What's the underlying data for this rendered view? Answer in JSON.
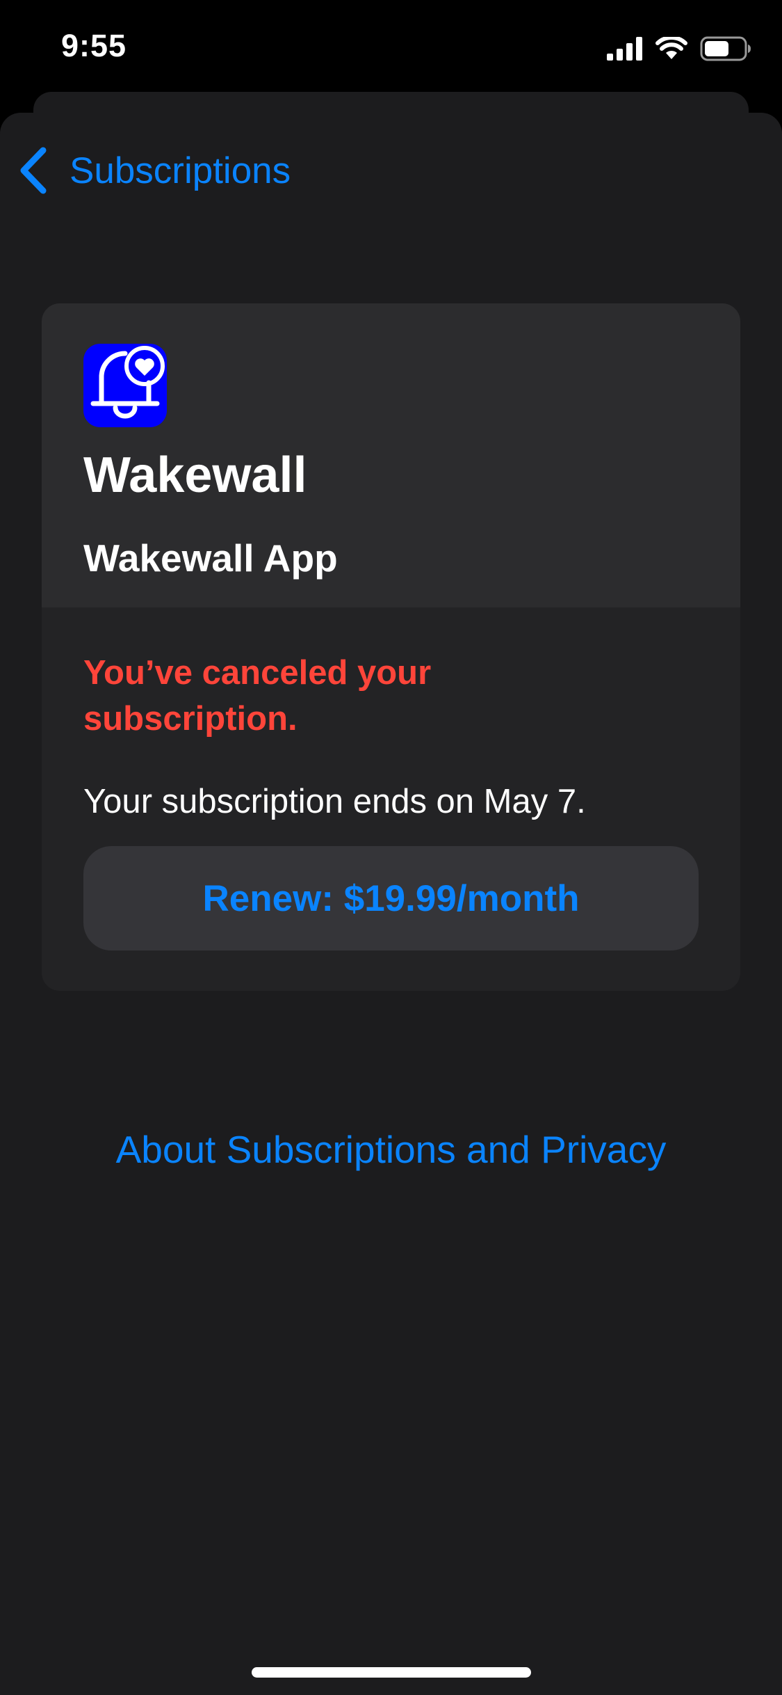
{
  "status_bar": {
    "time": "9:55",
    "icons": [
      "cellular-signal-icon",
      "wifi-icon",
      "battery-icon"
    ]
  },
  "nav": {
    "back_label": "Subscriptions",
    "back_icon": "chevron-left-icon"
  },
  "subscription": {
    "app_icon": "bell-heart-icon",
    "app_name": "Wakewall",
    "plan_name": "Wakewall App",
    "status_message": "You’ve canceled your subscription.",
    "end_message": "Your subscription ends on May 7.",
    "renew_button_label": "Renew: $19.99/month"
  },
  "footer": {
    "about_link": "About Subscriptions and Privacy"
  },
  "colors": {
    "background": "#1c1c1e",
    "card": "#2c2c2e",
    "accent": "#0a84ff",
    "destructive": "#ff453a",
    "app_icon_bg": "#0000ff"
  }
}
